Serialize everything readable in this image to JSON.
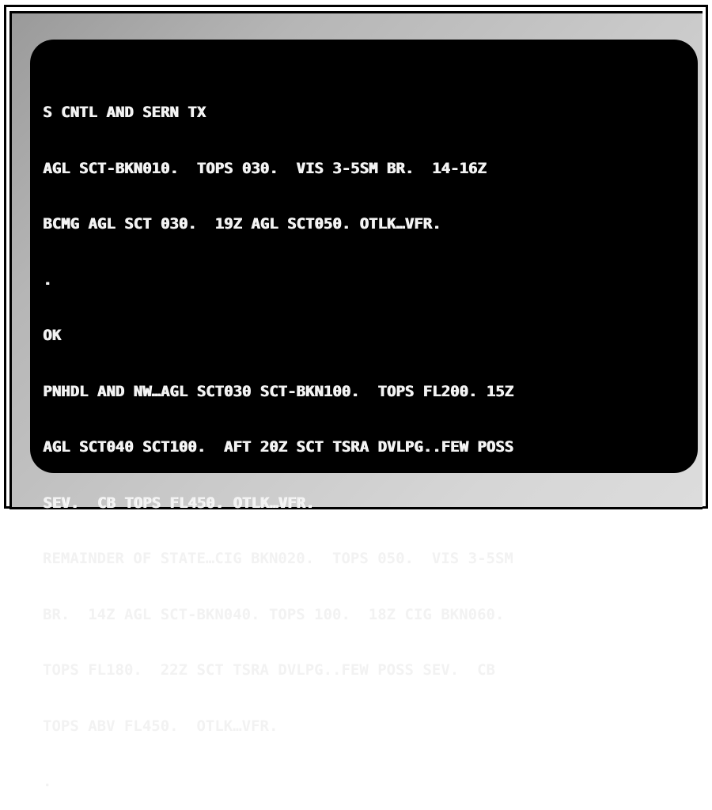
{
  "terminal": {
    "lines": [
      "S CNTL AND SERN TX",
      "AGL SCT-BKN010.  TOPS 030.  VIS 3-5SM BR.  14-16Z",
      "BCMG AGL SCT 030.  19Z AGL SCT050. OTLK…VFR.",
      ".",
      "OK",
      "PNHDL AND NW…AGL SCT030 SCT-BKN100.  TOPS FL200. 15Z",
      "AGL SCT040 SCT100.  AFT 20Z SCT TSRA DVLPG..FEW POSS",
      "SEV.  CB TOPS FL450. OTLK…VFR.",
      "REMAINDER OF STATE…CIG BKN020.  TOPS 050.  VIS 3-5SM",
      "BR.  14Z AGL SCT-BKN040. TOPS 100.  18Z CIG BKN060.",
      "TOPS FL180.  22Z SCT TSRA DVLPG..FEW POSS SEV.  CB",
      "TOPS ABV FL450.  OTLK…VFR.",
      "."
    ]
  },
  "colors": {
    "screen": "#000000",
    "text": "#f2f2f2",
    "bezel_dark": "#9a9a9a",
    "bezel_light": "#dcdcdc"
  }
}
